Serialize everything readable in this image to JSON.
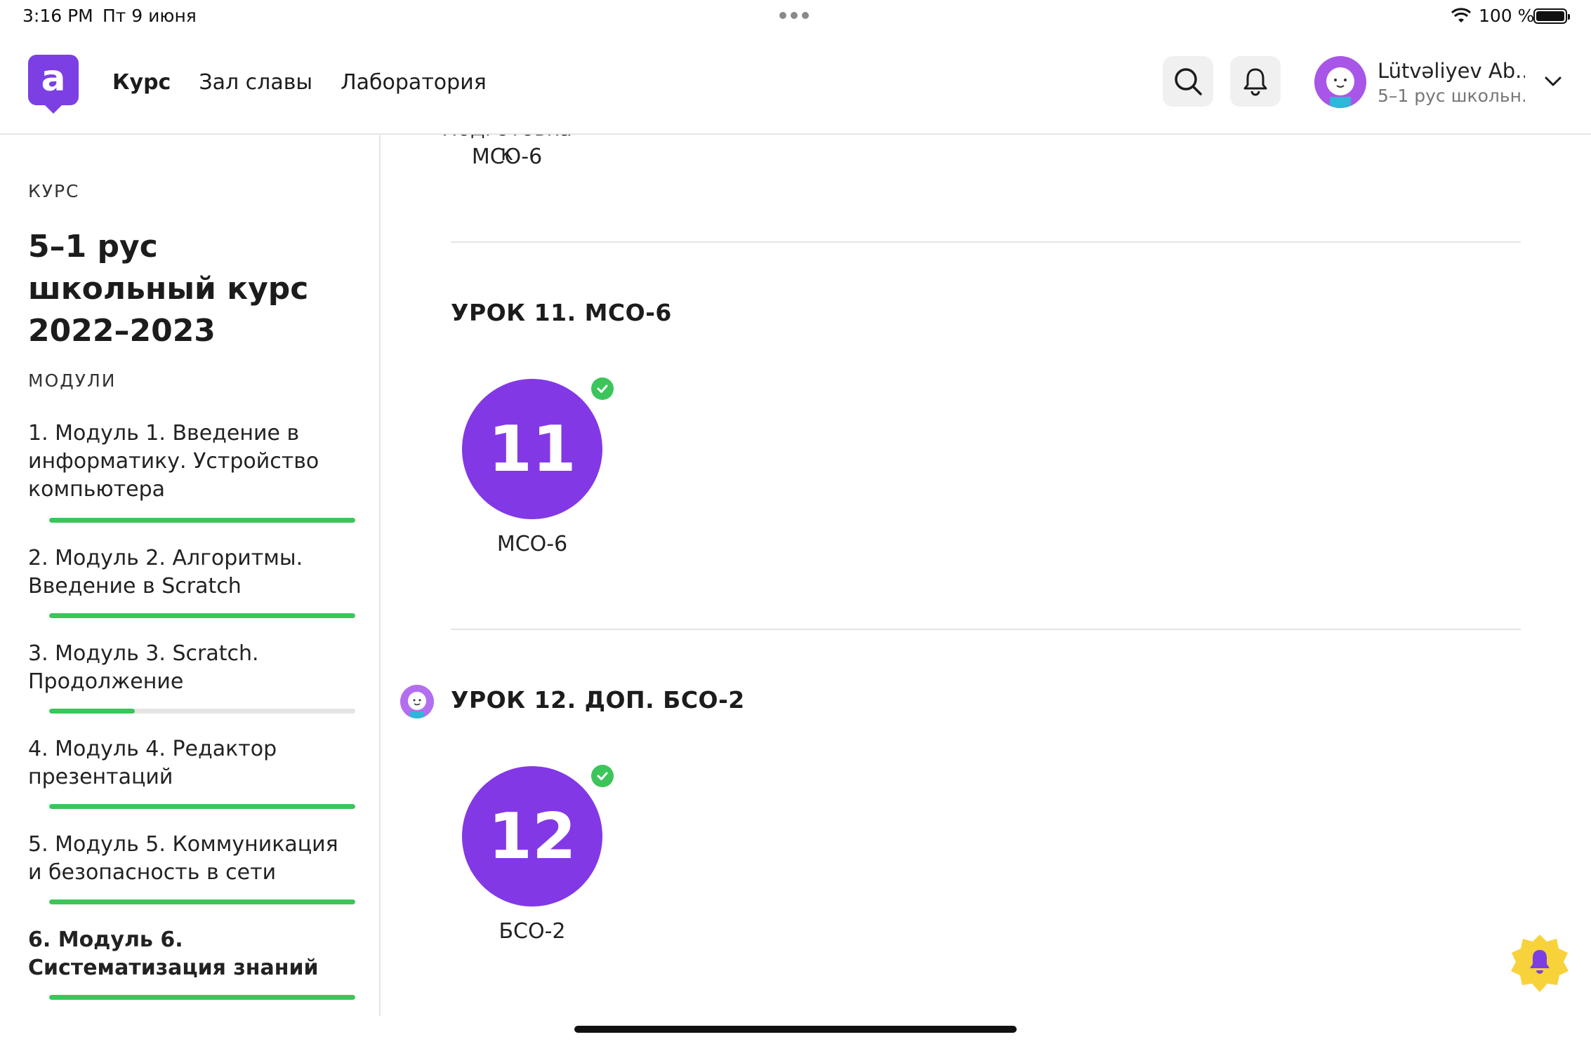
{
  "status": {
    "time": "3:16 PM",
    "date": "Пт 9 июня",
    "battery": "100 %"
  },
  "header": {
    "logo": "a",
    "nav": [
      "Курс",
      "Зал славы",
      "Лаборатория"
    ],
    "user_name": "Lütvəliyev Ab...",
    "user_course": "5–1 рус школьн..."
  },
  "sidebar": {
    "course_label": "КУРС",
    "course_title": "5–1 рус школьный курс 2022–2023",
    "modules_label": "МОДУЛИ",
    "modules": [
      {
        "label": "1. Модуль 1. Введение в информатику. Устройство компьютера",
        "progress": 1.0
      },
      {
        "label": "2. Модуль 2. Алгоритмы. Введение в Scratch",
        "progress": 1.0
      },
      {
        "label": "3. Модуль 3. Scratch. Продолжение",
        "progress": 0.28
      },
      {
        "label": "4. Модуль 4. Редактор презентаций",
        "progress": 1.0
      },
      {
        "label": "5. Модуль 5. Коммуникация и безопасность в сети",
        "progress": 1.0
      },
      {
        "label": "6. Модуль 6. Систематизация знаний",
        "progress": 1.0
      }
    ]
  },
  "main": {
    "prev_lesson_label_top": "Подготовка к",
    "prev_lesson_label_bottom": "МСО-6",
    "lessons": [
      {
        "title": "УРОК 11. МСО-6",
        "number": "11",
        "label": "МСО-6"
      },
      {
        "title": "УРОК 12. ДОП. БСО-2",
        "number": "12",
        "label": "БСО-2"
      }
    ]
  },
  "colors": {
    "accent": "#8338e6",
    "success": "#3cc55a",
    "fab": "#f7d23a"
  }
}
